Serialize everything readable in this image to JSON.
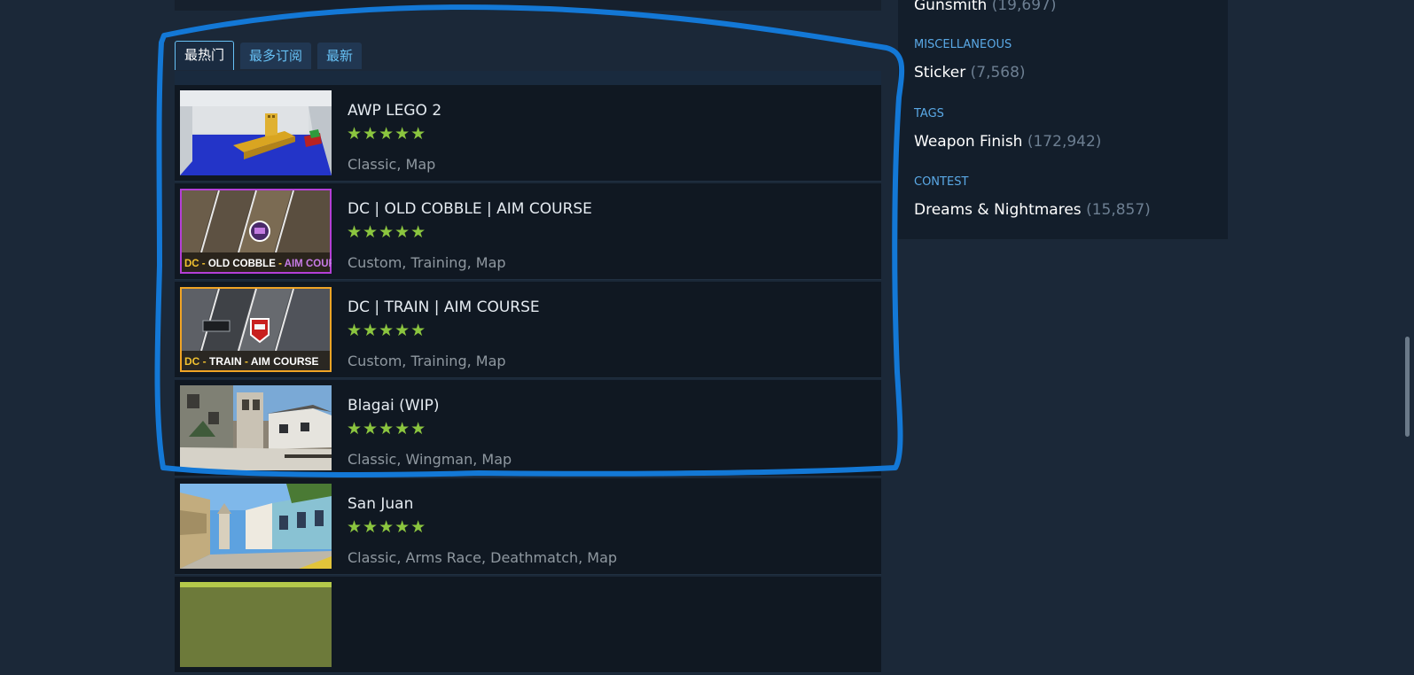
{
  "tabs": [
    {
      "label": "最热门",
      "active": true
    },
    {
      "label": "最多订阅",
      "active": false
    },
    {
      "label": "最新",
      "active": false
    }
  ],
  "items": [
    {
      "title": "AWP LEGO 2",
      "rating_stars": 5,
      "stars": "★★★★★",
      "tags": "Classic, Map"
    },
    {
      "title": "DC | OLD COBBLE | AIM COURSE",
      "rating_stars": 5,
      "stars": "★★★★★",
      "tags": "Custom, Training, Map",
      "thumb_text": "DC - OLD COBBLE - AIM COURSE",
      "thumb_text_parts": [
        "DC - ",
        "OLD COBBLE",
        " - ",
        "AIM COURSE"
      ]
    },
    {
      "title": "DC | TRAIN | AIM COURSE",
      "rating_stars": 5,
      "stars": "★★★★★",
      "tags": "Custom, Training, Map",
      "thumb_text": "DC - TRAIN - AIM COURSE",
      "thumb_text_parts": [
        "DC - ",
        "TRAIN",
        " - ",
        "AIM COURSE"
      ]
    },
    {
      "title": "Blagai (WIP)",
      "rating_stars": 5,
      "stars": "★★★★★",
      "tags": "Classic, Wingman, Map"
    },
    {
      "title": "San Juan",
      "rating_stars": 5,
      "stars": "★★★★★",
      "tags": "Classic, Arms Race, Deathmatch, Map"
    }
  ],
  "sidebar": {
    "top_entry": {
      "label": "Gunsmith",
      "count": "(19,697)"
    },
    "sections": [
      {
        "heading": "MISCELLANEOUS",
        "entry": {
          "label": "Sticker",
          "count": "(7,568)"
        }
      },
      {
        "heading": "TAGS",
        "entry": {
          "label": "Weapon Finish",
          "count": "(172,942)"
        }
      },
      {
        "heading": "CONTEST",
        "entry": {
          "label": "Dreams & Nightmares",
          "count": "(15,857)"
        }
      }
    ]
  },
  "colors": {
    "background": "#1b2838",
    "accent": "#67c1f5",
    "star": "#8bc53f",
    "annotation": "#1378d6"
  }
}
